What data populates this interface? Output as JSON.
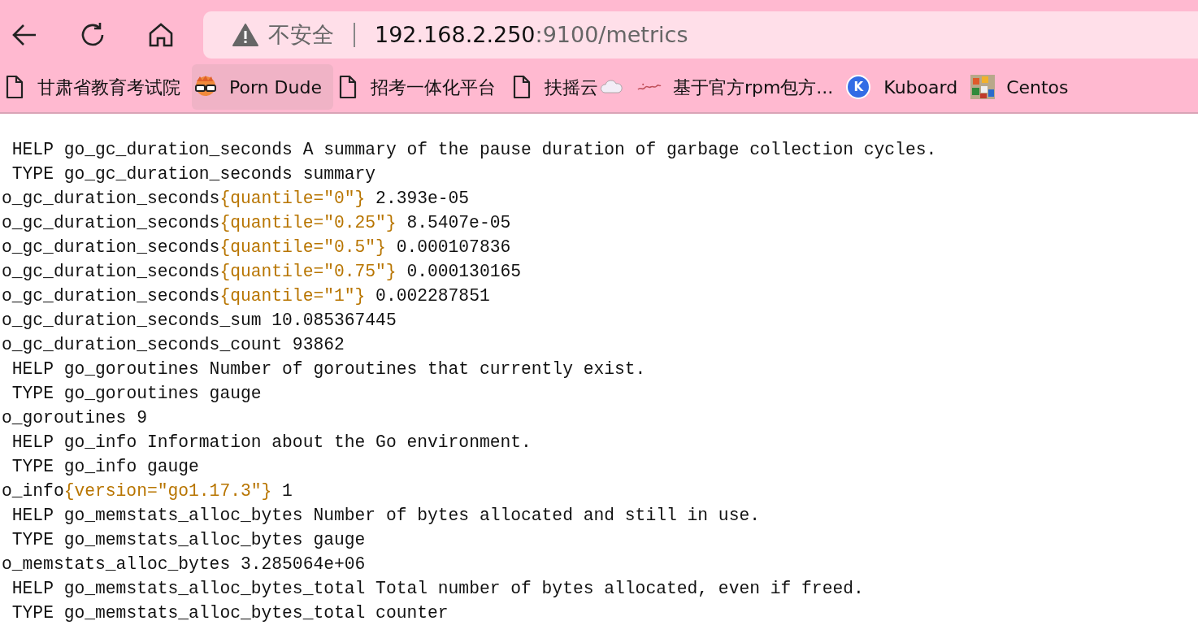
{
  "address_bar": {
    "security_label": "不安全",
    "host": "192.168.2.250",
    "rest": ":9100/metrics"
  },
  "bookmarks": [
    {
      "label": "甘肃省教育考试院",
      "hovered": false
    },
    {
      "label": "Porn Dude",
      "hovered": true
    },
    {
      "label": "招考一体化平台",
      "hovered": false
    },
    {
      "label": "扶摇云",
      "hovered": false
    },
    {
      "label": "基于官方rpm包方...",
      "hovered": false
    },
    {
      "label": "Kuboard",
      "icon_letter": "K",
      "hovered": false
    },
    {
      "label": "Centos",
      "hovered": false
    }
  ],
  "lines": [
    {
      "kind": "comment",
      "text": "HELP go_gc_duration_seconds A summary of the pause duration of garbage collection cycles."
    },
    {
      "kind": "comment",
      "text": "TYPE go_gc_duration_seconds summary"
    },
    {
      "kind": "sample",
      "name": "o_gc_duration_seconds",
      "labels": "{quantile=\"0\"}",
      "value": "2.393e-05"
    },
    {
      "kind": "sample",
      "name": "o_gc_duration_seconds",
      "labels": "{quantile=\"0.25\"}",
      "value": "8.5407e-05"
    },
    {
      "kind": "sample",
      "name": "o_gc_duration_seconds",
      "labels": "{quantile=\"0.5\"}",
      "value": "0.000107836"
    },
    {
      "kind": "sample",
      "name": "o_gc_duration_seconds",
      "labels": "{quantile=\"0.75\"}",
      "value": "0.000130165"
    },
    {
      "kind": "sample",
      "name": "o_gc_duration_seconds",
      "labels": "{quantile=\"1\"}",
      "value": "0.002287851"
    },
    {
      "kind": "sample",
      "name": "o_gc_duration_seconds_sum",
      "value": "10.085367445"
    },
    {
      "kind": "sample",
      "name": "o_gc_duration_seconds_count",
      "value": "93862"
    },
    {
      "kind": "comment",
      "text": "HELP go_goroutines Number of goroutines that currently exist."
    },
    {
      "kind": "comment",
      "text": "TYPE go_goroutines gauge"
    },
    {
      "kind": "sample",
      "name": "o_goroutines",
      "value": "9"
    },
    {
      "kind": "comment",
      "text": "HELP go_info Information about the Go environment."
    },
    {
      "kind": "comment",
      "text": "TYPE go_info gauge"
    },
    {
      "kind": "sample",
      "name": "o_info",
      "labels": "{version=\"go1.17.3\"}",
      "value": "1"
    },
    {
      "kind": "comment",
      "text": "HELP go_memstats_alloc_bytes Number of bytes allocated and still in use."
    },
    {
      "kind": "comment",
      "text": "TYPE go_memstats_alloc_bytes gauge"
    },
    {
      "kind": "sample",
      "name": "o_memstats_alloc_bytes",
      "value": "3.285064e+06"
    },
    {
      "kind": "comment",
      "text": "HELP go_memstats_alloc_bytes_total Total number of bytes allocated, even if freed."
    },
    {
      "kind": "comment",
      "text": "TYPE go_memstats_alloc_bytes_total counter"
    }
  ]
}
